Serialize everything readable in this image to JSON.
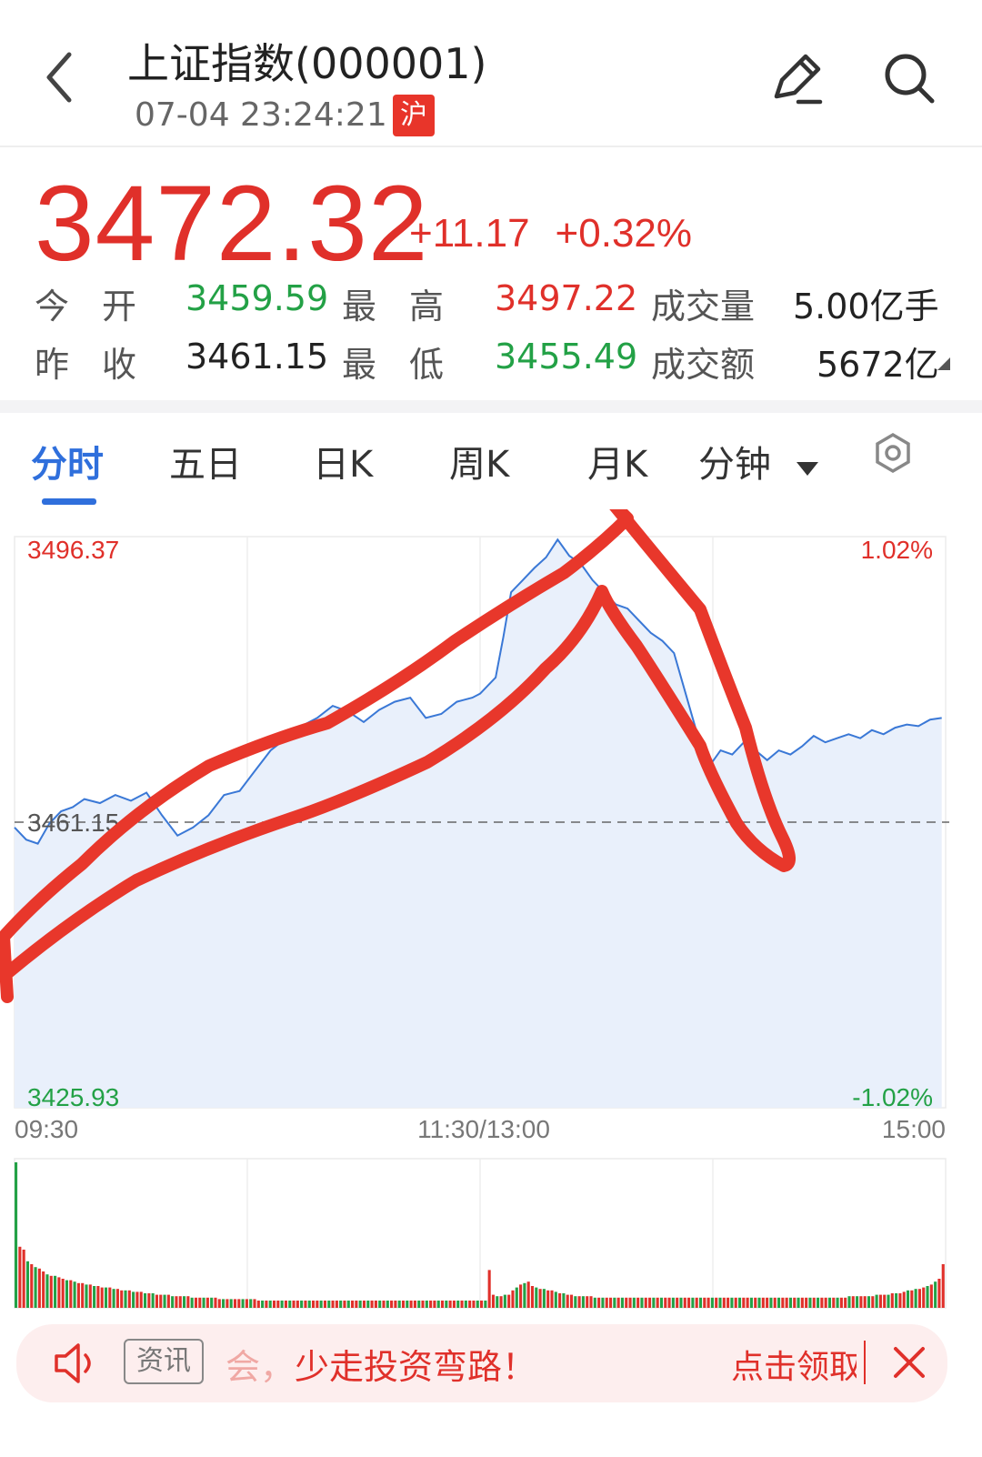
{
  "header": {
    "title": "上证指数(000001)",
    "datetime": "07-04 23:24:21",
    "market_badge": "沪",
    "icons": [
      "back-chevron-icon",
      "edit-pencil-icon",
      "search-icon"
    ]
  },
  "quote": {
    "price": "3472.32",
    "change": "+11.17",
    "change_pct": "+0.32%",
    "open_label": "今开",
    "open": "3459.59",
    "high_label": "最高",
    "high": "3497.22",
    "volume_label": "成交量",
    "volume": "5.00亿手",
    "prev_close_label": "昨收",
    "prev_close": "3461.15",
    "low_label": "最低",
    "low": "3455.49",
    "amount_label": "成交额",
    "amount": "5672亿"
  },
  "tabs": [
    {
      "label": "分时",
      "active": true
    },
    {
      "label": "五日"
    },
    {
      "label": "日K"
    },
    {
      "label": "周K"
    },
    {
      "label": "月K"
    },
    {
      "label": "分钟"
    }
  ],
  "chart_data": {
    "type": "line",
    "y_max_label": "3496.37",
    "y_min_label": "3425.93",
    "pct_max_label": "1.02%",
    "pct_min_label": "-1.02%",
    "prev_close_label": "3461.15",
    "ylim": [
      3425.93,
      3496.37
    ],
    "x_ticks": [
      "09:30",
      "11:30/13:00",
      "15:00"
    ],
    "total_points": 240,
    "series": [
      {
        "points": [
          [
            0,
            3460.5
          ],
          [
            3,
            3459.0
          ],
          [
            6,
            3458.5
          ],
          [
            9,
            3461.0
          ],
          [
            12,
            3462.5
          ],
          [
            15,
            3463.0
          ],
          [
            18,
            3464.0
          ],
          [
            22,
            3463.5
          ],
          [
            26,
            3464.5
          ],
          [
            30,
            3463.8
          ],
          [
            34,
            3464.8
          ],
          [
            38,
            3462.0
          ],
          [
            42,
            3459.5
          ],
          [
            46,
            3460.5
          ],
          [
            50,
            3462.0
          ],
          [
            54,
            3464.5
          ],
          [
            58,
            3465.0
          ],
          [
            62,
            3467.5
          ],
          [
            66,
            3470.0
          ],
          [
            70,
            3471.5
          ],
          [
            74,
            3473.0
          ],
          [
            78,
            3474.0
          ],
          [
            82,
            3475.5
          ],
          [
            86,
            3474.8
          ],
          [
            90,
            3473.5
          ],
          [
            94,
            3475.0
          ],
          [
            98,
            3476.0
          ],
          [
            102,
            3476.5
          ],
          [
            106,
            3474.0
          ],
          [
            110,
            3474.5
          ],
          [
            114,
            3476.0
          ],
          [
            118,
            3476.5
          ],
          [
            120,
            3477.0
          ],
          [
            124,
            3479.0
          ],
          [
            126,
            3484.0
          ],
          [
            128,
            3489.5
          ],
          [
            131,
            3491.0
          ],
          [
            134,
            3492.5
          ],
          [
            137,
            3493.8
          ],
          [
            140,
            3496.0
          ],
          [
            143,
            3494.0
          ],
          [
            146,
            3493.0
          ],
          [
            149,
            3491.0
          ],
          [
            152,
            3489.5
          ],
          [
            155,
            3488.0
          ],
          [
            158,
            3487.5
          ],
          [
            161,
            3486.0
          ],
          [
            164,
            3484.5
          ],
          [
            167,
            3483.5
          ],
          [
            170,
            3482.0
          ],
          [
            173,
            3477.0
          ],
          [
            176,
            3472.0
          ],
          [
            179,
            3468.0
          ],
          [
            182,
            3470.0
          ],
          [
            185,
            3469.5
          ],
          [
            188,
            3471.0
          ],
          [
            191,
            3470.0
          ],
          [
            194,
            3468.8
          ],
          [
            197,
            3470.0
          ],
          [
            200,
            3469.5
          ],
          [
            203,
            3470.5
          ],
          [
            206,
            3471.8
          ],
          [
            209,
            3471.0
          ],
          [
            212,
            3471.5
          ],
          [
            215,
            3472.0
          ],
          [
            218,
            3471.5
          ],
          [
            221,
            3472.5
          ],
          [
            224,
            3472.0
          ],
          [
            227,
            3472.8
          ],
          [
            230,
            3473.2
          ],
          [
            233,
            3473.0
          ],
          [
            236,
            3473.8
          ],
          [
            239,
            3474.0
          ]
        ]
      }
    ],
    "volume_bars": {
      "values": [
        100,
        42,
        40,
        32,
        30,
        28,
        27,
        25,
        23,
        22,
        22,
        21,
        20,
        19,
        19,
        18,
        17,
        17,
        16,
        16,
        15,
        15,
        14,
        14,
        14,
        13,
        13,
        12,
        12,
        12,
        11,
        11,
        11,
        10,
        10,
        10,
        9,
        9,
        9,
        9,
        8,
        8,
        8,
        8,
        8,
        7,
        7,
        7,
        7,
        7,
        7,
        7,
        6,
        6,
        6,
        6,
        6,
        6,
        6,
        6,
        6,
        6,
        5,
        5,
        5,
        5,
        5,
        5,
        5,
        5,
        5,
        5,
        5,
        5,
        5,
        5,
        5,
        5,
        5,
        5,
        5,
        5,
        5,
        5,
        5,
        5,
        5,
        5,
        5,
        5,
        5,
        5,
        5,
        5,
        5,
        5,
        5,
        5,
        5,
        5,
        5,
        5,
        5,
        5,
        5,
        5,
        5,
        5,
        5,
        5,
        5,
        5,
        5,
        5,
        5,
        5,
        5,
        5,
        5,
        5,
        5,
        26,
        9,
        8,
        8,
        9,
        9,
        12,
        14,
        16,
        17,
        18,
        15,
        14,
        13,
        13,
        12,
        12,
        11,
        10,
        10,
        9,
        9,
        8,
        8,
        8,
        8,
        8,
        7,
        7,
        7,
        7,
        7,
        7,
        7,
        7,
        7,
        7,
        7,
        7,
        7,
        7,
        7,
        7,
        7,
        7,
        7,
        7,
        7,
        7,
        7,
        7,
        7,
        7,
        7,
        7,
        7,
        7,
        7,
        7,
        7,
        7,
        7,
        7,
        7,
        7,
        7,
        7,
        7,
        7,
        7,
        7,
        7,
        7,
        7,
        7,
        7,
        7,
        7,
        7,
        7,
        7,
        7,
        7,
        7,
        7,
        7,
        7,
        7,
        7,
        7,
        7,
        7,
        8,
        8,
        8,
        8,
        8,
        8,
        8,
        9,
        9,
        9,
        9,
        10,
        10,
        10,
        11,
        12,
        12,
        13,
        13,
        14,
        15,
        16,
        18,
        20,
        30
      ],
      "up_color": "#e0302a",
      "down_color": "#23a146"
    },
    "colors": {
      "line": "#3a78d6",
      "fill": "#e9f0fb",
      "up": "#e0302a",
      "down": "#23a146",
      "annotation": "#e8372b"
    },
    "annotation": "red hand-drawn loop over the price line"
  },
  "news": {
    "tag": "资讯",
    "text_faded": "会，",
    "text": "少走投资弯路！",
    "cta": "点击领取",
    "icons": [
      "speaker-icon",
      "close-icon"
    ]
  }
}
